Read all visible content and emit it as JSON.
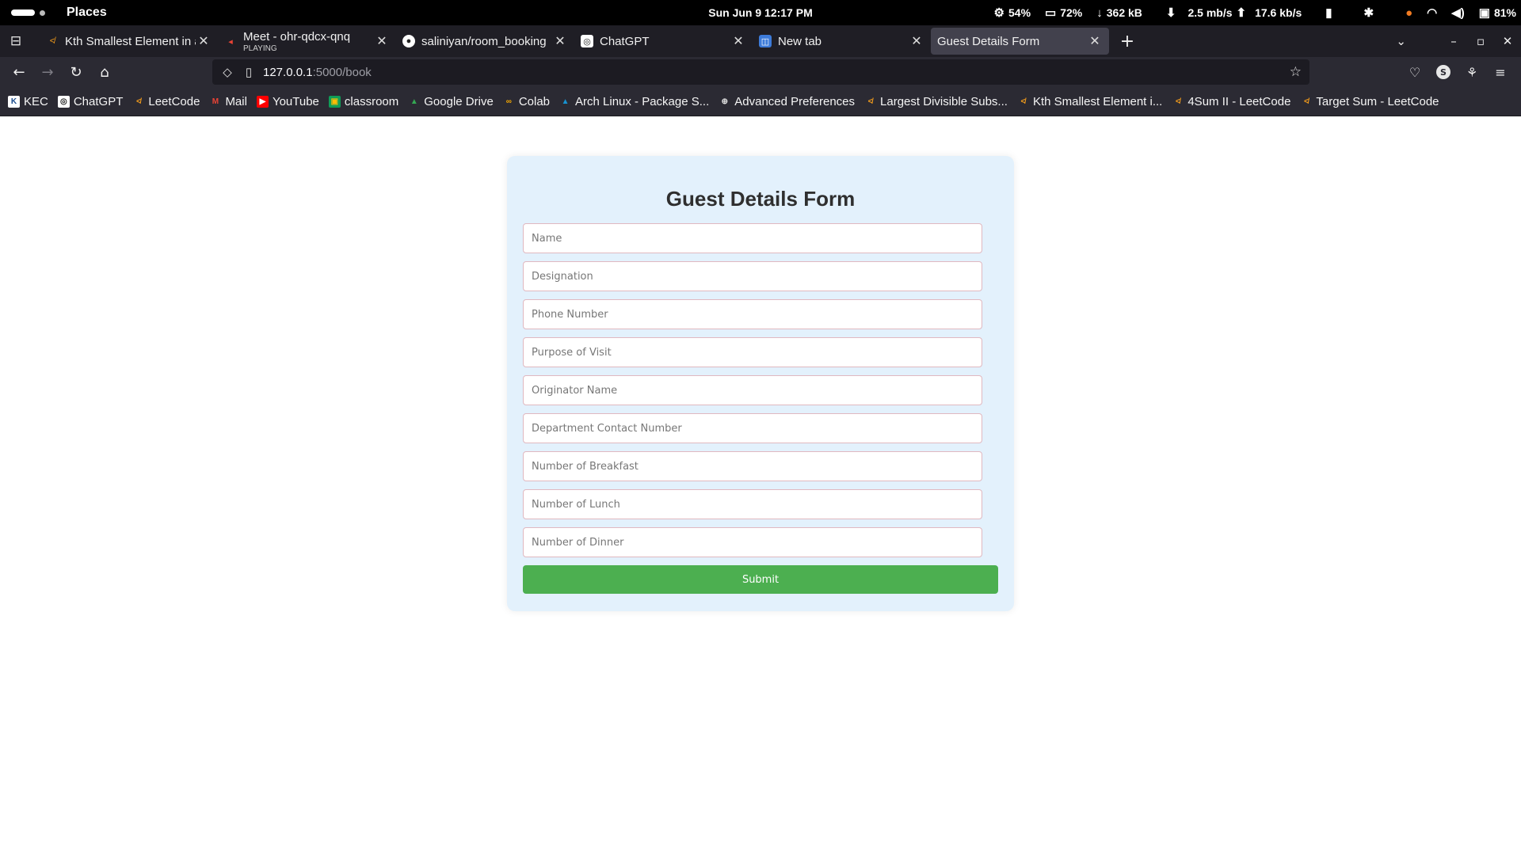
{
  "system_bar": {
    "places": "Places",
    "clock": "Sun Jun 9  12:17 PM",
    "cpu": "54%",
    "memory": "72%",
    "net_total": "362 kB",
    "download": "2.5 mb/s",
    "upload": "17.6 kb/s",
    "battery": "81%"
  },
  "tabs": [
    {
      "title": "Kth Smallest Element in a",
      "sub": "",
      "active": false
    },
    {
      "title": "Meet - ohr-qdcx-qnq",
      "sub": "PLAYING",
      "active": false
    },
    {
      "title": "saliniyan/room_booking",
      "sub": "",
      "active": false
    },
    {
      "title": "ChatGPT",
      "sub": "",
      "active": false
    },
    {
      "title": "New tab",
      "sub": "",
      "active": false
    },
    {
      "title": "Guest Details Form",
      "sub": "",
      "active": true
    }
  ],
  "urlbar": {
    "host": "127.0.0.1",
    "path": ":5000/book"
  },
  "bookmarks": [
    {
      "label": "KEC",
      "icon": "K",
      "color": "#ffffff",
      "fg": "#1a4b8c"
    },
    {
      "label": "ChatGPT",
      "icon": "◎",
      "color": "#ffffff",
      "fg": "#222"
    },
    {
      "label": "LeetCode",
      "icon": "≮",
      "color": "#2b2a33",
      "fg": "#f89f1b"
    },
    {
      "label": "Mail",
      "icon": "M",
      "color": "#2b2a33",
      "fg": "#ea4335"
    },
    {
      "label": "YouTube",
      "icon": "▶",
      "color": "#ff0000",
      "fg": "#ffffff"
    },
    {
      "label": "classroom",
      "icon": "▣",
      "color": "#0f9d58",
      "fg": "#fbbc04"
    },
    {
      "label": "Google Drive",
      "icon": "▲",
      "color": "#2b2a33",
      "fg": "#34a853"
    },
    {
      "label": "Colab",
      "icon": "∞",
      "color": "#2b2a33",
      "fg": "#f9ab00"
    },
    {
      "label": "Arch Linux - Package S...",
      "icon": "▲",
      "color": "#2b2a33",
      "fg": "#1793d1"
    },
    {
      "label": "Advanced Preferences",
      "icon": "⊕",
      "color": "#2b2a33",
      "fg": "#e0e0e0"
    },
    {
      "label": "Largest Divisible Subs...",
      "icon": "≮",
      "color": "#2b2a33",
      "fg": "#f89f1b"
    },
    {
      "label": "Kth Smallest Element i...",
      "icon": "≮",
      "color": "#2b2a33",
      "fg": "#f89f1b"
    },
    {
      "label": "4Sum II - LeetCode",
      "icon": "≮",
      "color": "#2b2a33",
      "fg": "#f89f1b"
    },
    {
      "label": "Target Sum - LeetCode",
      "icon": "≮",
      "color": "#2b2a33",
      "fg": "#f89f1b"
    }
  ],
  "form": {
    "title": "Guest Details Form",
    "fields": [
      {
        "name": "name-input",
        "placeholder": "Name",
        "value": ""
      },
      {
        "name": "designation-input",
        "placeholder": "Designation",
        "value": ""
      },
      {
        "name": "phone-number-input",
        "placeholder": "Phone Number",
        "value": ""
      },
      {
        "name": "purpose-of-visit-input",
        "placeholder": "Purpose of Visit",
        "value": ""
      },
      {
        "name": "originator-name-input",
        "placeholder": "Originator Name",
        "value": ""
      },
      {
        "name": "department-contact-number-input",
        "placeholder": "Department Contact Number",
        "value": ""
      },
      {
        "name": "number-of-breakfast-input",
        "placeholder": "Number of Breakfast",
        "value": ""
      },
      {
        "name": "number-of-lunch-input",
        "placeholder": "Number of Lunch",
        "value": ""
      },
      {
        "name": "number-of-dinner-input",
        "placeholder": "Number of Dinner",
        "value": ""
      }
    ],
    "submit_label": "Submit"
  },
  "colors": {
    "card_bg": "#e3f1fc",
    "submit_bg": "#4caf50",
    "field_border": "#e0b8c0",
    "active_tab": "#42414d"
  }
}
